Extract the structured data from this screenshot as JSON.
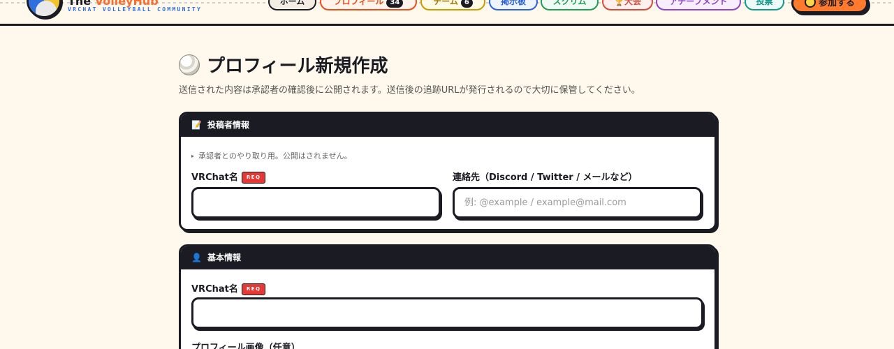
{
  "header": {
    "brand_word1": "The",
    "brand_word2": "VolleyHub",
    "brand_sub": "VRCHAT VOLLEYBALL COMMUNITY",
    "nav": [
      {
        "label": "ホーム"
      },
      {
        "label": "プロフィール",
        "badge": "34"
      },
      {
        "label": "チーム",
        "badge": "6"
      },
      {
        "label": "掲示板"
      },
      {
        "label": "スクリム"
      },
      {
        "label": "大会",
        "icon": "🏆"
      },
      {
        "label": "アチーブメント"
      },
      {
        "label": "投票"
      }
    ],
    "join_label": "参加する"
  },
  "page": {
    "title": "プロフィール新規作成",
    "description": "送信された内容は承認者の確認後に公開されます。送信後の追跡URLが発行されるので大切に保管してください。"
  },
  "poster_section": {
    "icon": "📝",
    "title": "投稿者情報",
    "note": "承認者とのやり取り用。公開はされません。",
    "vrchat_label": "VRChat名",
    "req_label": "REQ",
    "contact_label": "連絡先（Discord / Twitter / メールなど）",
    "contact_placeholder": "例: @example / example@mail.com",
    "vrchat_value": "",
    "contact_value": ""
  },
  "basic_section": {
    "icon": "👤",
    "title": "基本情報",
    "vrchat_label": "VRChat名",
    "req_label": "REQ",
    "vrchat_value": "",
    "image_label": "プロフィール画像（任意）"
  },
  "colors": {
    "background": "#fff8ec",
    "ink": "#1b1b24",
    "accent_orange": "#ff7a2c",
    "brand_blue": "#2f6fe0",
    "req_red": "#e53935",
    "nav_home": "#1b1b24",
    "nav_profile": "#e8501a",
    "nav_team": "#c99a00",
    "nav_board": "#2a62d6",
    "nav_scrim": "#1f9d55",
    "nav_tournament": "#d84a3a",
    "nav_achievement": "#8e44c9",
    "nav_vote": "#149a8a"
  }
}
